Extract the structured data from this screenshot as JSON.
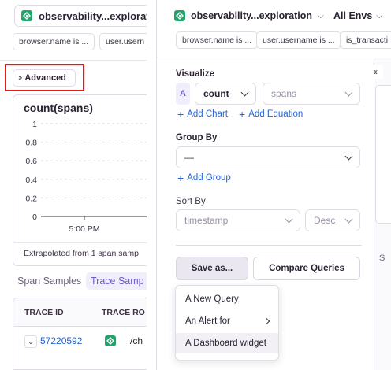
{
  "left": {
    "project": "observability...exploration",
    "filters": [
      "browser.name is ...",
      "user.usern"
    ],
    "advanced_label": "Advanced",
    "chart": {
      "title": "count(spans)",
      "footer": "Extrapolated from 1 span samp"
    },
    "tabs": {
      "samples": "Span Samples",
      "traces": "Trace Samp"
    },
    "table": {
      "col_trace_id": "TRACE ID",
      "col_trace_root": "TRACE RO",
      "row_trace_id": "57220592",
      "row_root": "/ch"
    }
  },
  "panel": {
    "project": "observability...exploration",
    "env": "All Envs",
    "filters": [
      "browser.name is ...",
      "user.username is ...",
      "is_transacti"
    ],
    "visualize": {
      "label": "Visualize",
      "query_letter": "A",
      "aggregate": "count",
      "field_placeholder": "spans",
      "add_chart": "Add Chart",
      "add_equation": "Add Equation"
    },
    "group_by": {
      "label": "Group By",
      "value": "—",
      "add_group": "Add Group"
    },
    "sort_by": {
      "label": "Sort By",
      "field": "timestamp",
      "order": "Desc"
    },
    "save_as": "Save as...",
    "compare": "Compare Queries",
    "menu": [
      "A New Query",
      "An Alert for",
      "A Dashboard widget"
    ],
    "collapse_icon": "double-chevron-left-icon",
    "side_letter": "S"
  },
  "chart_data": {
    "type": "line",
    "title": "count(spans)",
    "x": [
      "5:00 PM"
    ],
    "series": [],
    "ylim": [
      0,
      1
    ],
    "yticks": [
      0,
      0.2,
      0.4,
      0.6,
      0.8,
      1
    ],
    "grid": true,
    "footer": "Extrapolated from 1 span samp"
  },
  "colors": {
    "accent": "#6c5fc7",
    "link": "#2562d4",
    "highlight_box": "#e01919",
    "project_icon": "#22a36b"
  }
}
